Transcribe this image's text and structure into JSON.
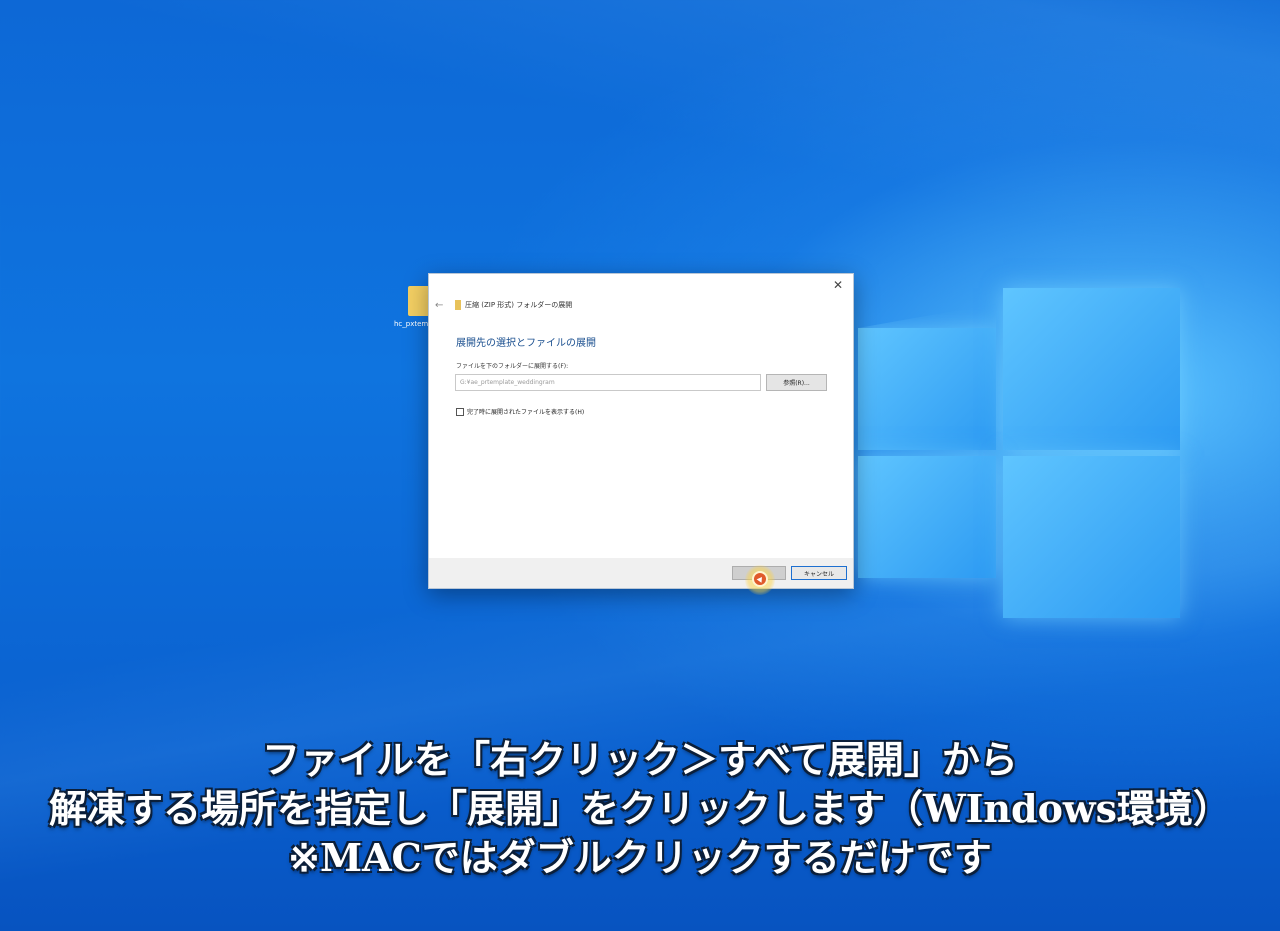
{
  "desktop": {
    "icon_label": "hc_pxtemp"
  },
  "dialog": {
    "title": "圧縮 (ZIP 形式) フォルダーの展開",
    "close_glyph": "✕",
    "back_glyph": "←",
    "heading": "展開先の選択とファイルの展開",
    "dest_label": "ファイルを下のフォルダーに展開する(F):",
    "path_value": "G:¥ae_prtemplate_weddingram",
    "browse_label": "参照(R)...",
    "show_files_label": "完了時に展開されたファイルを表示する(H)",
    "show_files_checked": false,
    "extract_label": "",
    "cancel_label": "キャンセル"
  },
  "caption": {
    "line1": "ファイルを「右クリック＞すべて展開」から",
    "line2": "解凍する場所を指定し「展開」をクリックします（WIndows環境）",
    "line3": "※MACではダブルクリックするだけです"
  },
  "colors": {
    "desktop_blue": "#0f74df",
    "accent_blue": "#1d6fd0",
    "heading_blue": "#1a4f8f"
  }
}
